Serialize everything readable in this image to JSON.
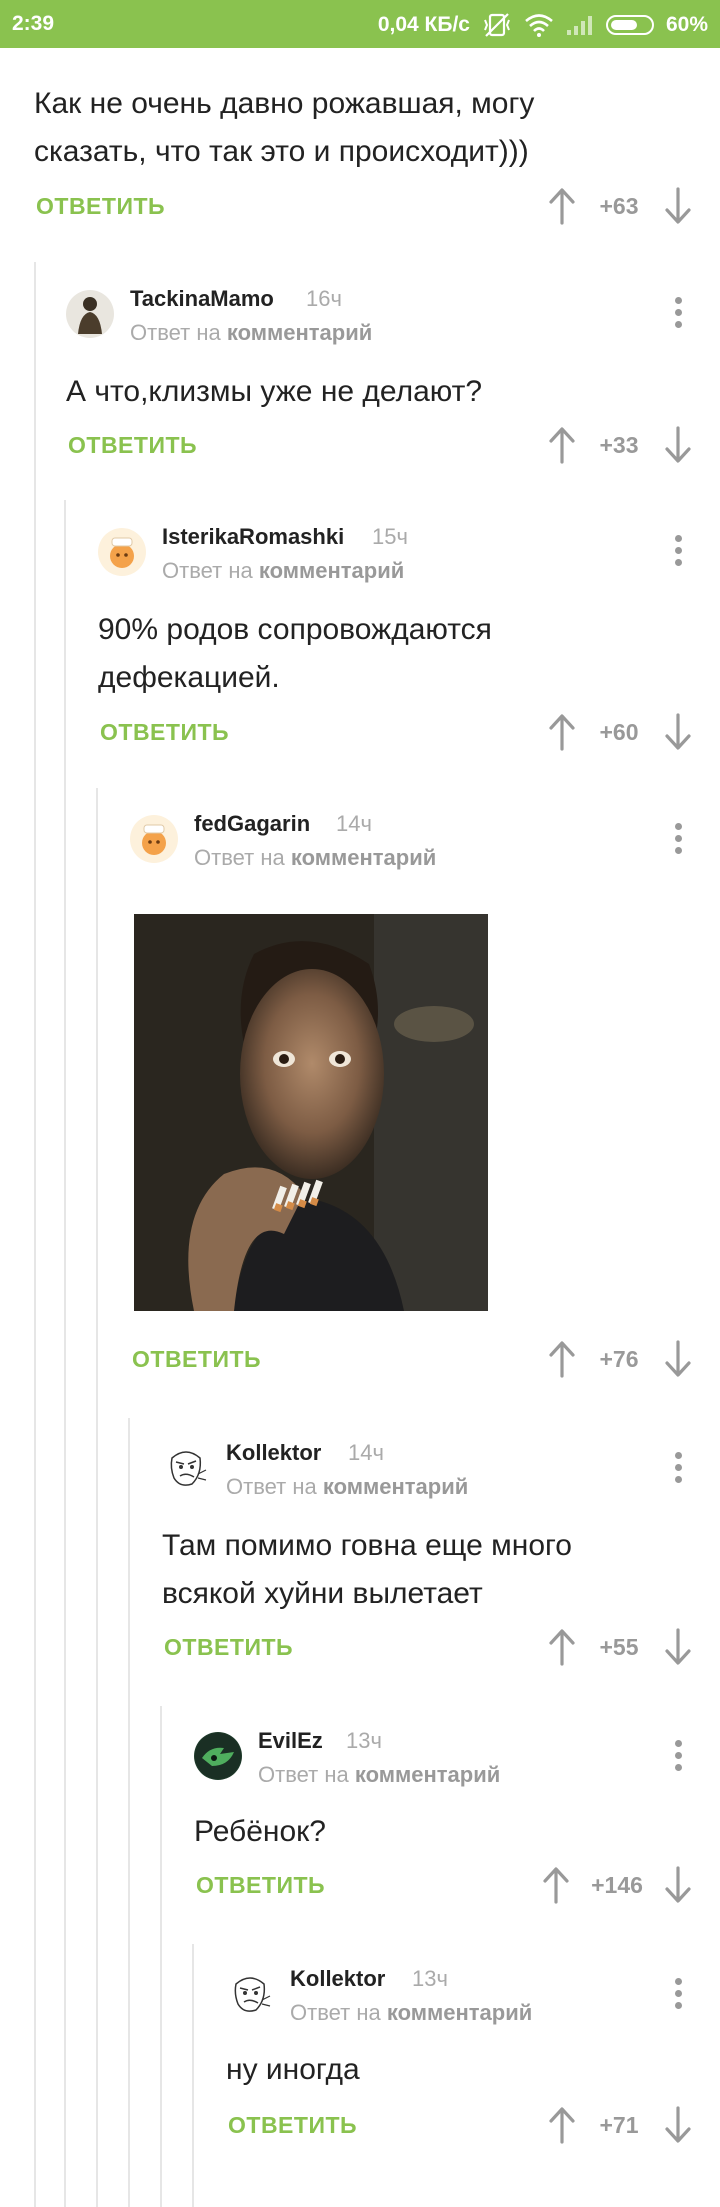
{
  "status_bar": {
    "time": "2:39",
    "speed": "0,04 КБ/с",
    "battery": "60%"
  },
  "labels": {
    "reply": "ОТВЕТИТЬ",
    "reply_to_prefix": "Ответ на",
    "reply_to_link": "комментарий"
  },
  "comments": [
    {
      "text": "Как не очень давно рожавшая,  могу сказать, что так это и происходит)))",
      "rating": "+63"
    },
    {
      "user": "TackinaMamo",
      "time": "16ч",
      "text": "А что,клизмы уже не делают?",
      "rating": "+33"
    },
    {
      "user": "IsterikaRomashki",
      "time": "15ч",
      "text": "90% родов сопровождаются дефекацией.",
      "rating": "+60"
    },
    {
      "user": "fedGagarin",
      "time": "14ч",
      "text": "",
      "rating": "+76"
    },
    {
      "user": "Kollektor",
      "time": "14ч",
      "text": "Там помимо говна еще много всякой хуйни вылетает",
      "rating": "+55"
    },
    {
      "user": "EvilEz",
      "time": "13ч",
      "text": "Ребёнок?",
      "rating": "+146"
    },
    {
      "user": "Kollektor",
      "time": "13ч",
      "text": "ну иногда",
      "rating": "+71"
    }
  ],
  "colors": {
    "accent": "#8ac24f",
    "muted": "#999999"
  }
}
